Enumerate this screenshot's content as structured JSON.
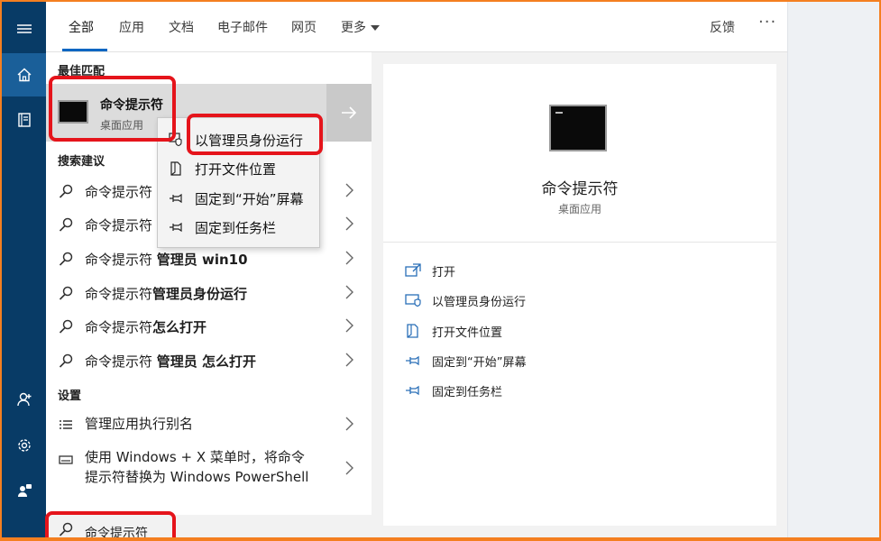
{
  "colors": {
    "accent": "#0a66c2",
    "rail": "#083b66",
    "highlight": "#e5141b",
    "frame": "#f47f20"
  },
  "rail": {
    "menu_icon": "hamburger-icon",
    "items": [
      {
        "name": "home",
        "icon": "home-icon",
        "active": true
      },
      {
        "name": "notebook",
        "icon": "notebook-icon",
        "active": false
      },
      {
        "name": "account",
        "icon": "person-icon",
        "active": false
      },
      {
        "name": "settings",
        "icon": "gear-icon",
        "active": false
      },
      {
        "name": "feedback-person",
        "icon": "person-feedback-icon",
        "active": false
      }
    ]
  },
  "tabs": [
    "全部",
    "应用",
    "文档",
    "电子邮件",
    "网页",
    "更多"
  ],
  "header": {
    "feedback": "反馈",
    "more_options": "···"
  },
  "best_match": {
    "heading": "最佳匹配",
    "title": "命令提示符",
    "subtitle": "桌面应用",
    "open_icon": "arrow-right-icon"
  },
  "context_menu": [
    {
      "label": "以管理员身份运行",
      "icon": "shield-icon"
    },
    {
      "label": "打开文件位置",
      "icon": "file-location-icon"
    },
    {
      "label": "固定到“开始”屏幕",
      "icon": "pin-icon"
    },
    {
      "label": "固定到任务栏",
      "icon": "pin-icon"
    }
  ],
  "suggestions": {
    "heading": "搜索建议",
    "items": [
      {
        "plain": "命令提示符",
        "bold": ""
      },
      {
        "plain": "命令提示符",
        "bold": ""
      },
      {
        "plain": "命令提示符 ",
        "bold": "管理员 win10"
      },
      {
        "plain": "命令提示符",
        "bold": "管理员身份运行"
      },
      {
        "plain": "命令提示符",
        "bold": "怎么打开"
      },
      {
        "plain": "命令提示符 ",
        "bold": "管理员 怎么打开"
      }
    ]
  },
  "settings": {
    "heading": "设置",
    "items": [
      {
        "line1": "管理应用执行别名",
        "line2": "",
        "icon": "list-icon"
      },
      {
        "line1": "使用 Windows + X 菜单时，将命令",
        "line2": "提示符替换为 Windows PowerShell",
        "icon": "keyboard-icon"
      }
    ]
  },
  "preview": {
    "title": "命令提示符",
    "subtitle": "桌面应用",
    "actions": [
      {
        "label": "打开",
        "icon": "open-icon"
      },
      {
        "label": "以管理员身份运行",
        "icon": "shield-icon"
      },
      {
        "label": "打开文件位置",
        "icon": "file-location-icon"
      },
      {
        "label": "固定到“开始”屏幕",
        "icon": "pin-icon"
      },
      {
        "label": "固定到任务栏",
        "icon": "pin-icon"
      }
    ]
  },
  "search": {
    "query": "命令提示符",
    "icon": "search-icon"
  }
}
